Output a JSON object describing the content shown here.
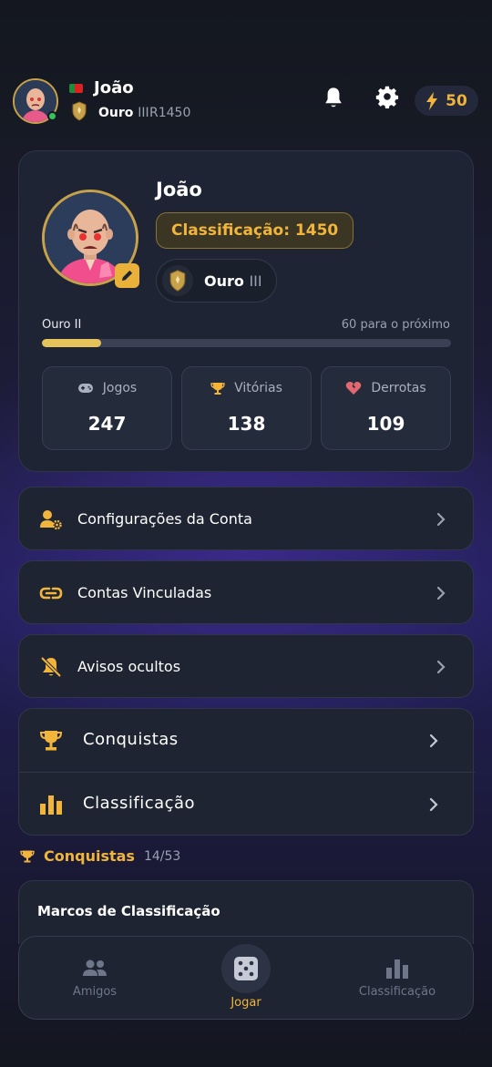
{
  "header": {
    "name": "João",
    "rank_name": "Ouro",
    "rank_tier": "III",
    "rating": "R1450",
    "energy": "50"
  },
  "profile": {
    "name": "João",
    "rating_label": "Classificação: 1450",
    "rank_name": "Ouro",
    "rank_tier": "III",
    "next_rank": "Ouro II",
    "next_text": "60 para o próximo",
    "progress": 0.145
  },
  "stats": [
    {
      "label": "Jogos",
      "value": "247",
      "icon": "gamepad-icon"
    },
    {
      "label": "Vitórias",
      "value": "138",
      "icon": "trophy-icon"
    },
    {
      "label": "Derrotas",
      "value": "109",
      "icon": "broken-heart-icon"
    }
  ],
  "menu": [
    {
      "label": "Configurações da Conta",
      "icon": "user-gear-icon"
    },
    {
      "label": "Contas Vinculadas",
      "icon": "link-icon"
    },
    {
      "label": "Avisos ocultos",
      "icon": "bell-slash-icon"
    }
  ],
  "group": [
    {
      "label": "Conquistas",
      "icon": "trophy-icon"
    },
    {
      "label": "Classificação",
      "icon": "bar-chart-icon"
    }
  ],
  "achievements": {
    "title": "Conquistas",
    "count": "14/53",
    "milestones_title": "Marcos de Classificação"
  },
  "nav": [
    {
      "label": "Amigos",
      "icon": "friends-icon"
    },
    {
      "label": "Jogar",
      "icon": "dice-icon"
    },
    {
      "label": "Classificação",
      "icon": "bar-chart-icon"
    }
  ],
  "colors": {
    "accent": "#f1b53c",
    "progress_fill": "#e5c35a",
    "online": "#37c25a"
  }
}
